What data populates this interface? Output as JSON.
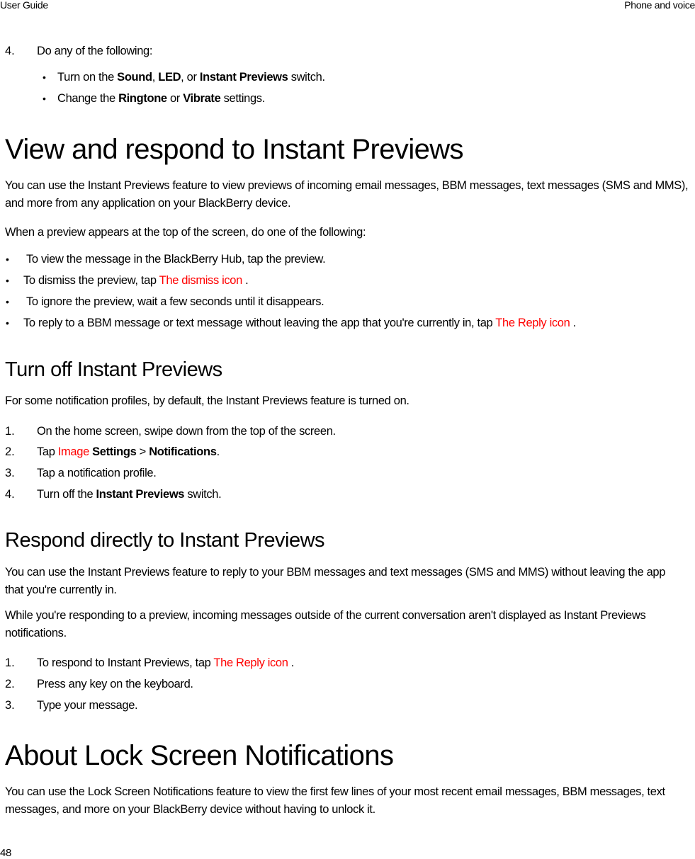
{
  "header": {
    "left": "User Guide",
    "right": "Phone and voice"
  },
  "page_number": "48",
  "intro_step": {
    "number": "4.",
    "text": "Do any of the following:",
    "bullets": [
      {
        "pre": "Turn on the ",
        "b1": "Sound",
        "mid1": ", ",
        "b2": "LED",
        "mid2": ", or ",
        "b3": "Instant Previews",
        "post": " switch."
      },
      {
        "pre": "Change the ",
        "b1": "Ringtone",
        "mid1": " or ",
        "b2": "Vibrate",
        "post": " settings."
      }
    ]
  },
  "section_view": {
    "title": "View and respond to Instant Previews",
    "para1": "You can use the Instant Previews feature to view previews of incoming email messages, BBM messages, text messages (SMS and MMS), and more from any application on your BlackBerry device.",
    "para2": "When a preview appears at the top of the screen, do one of the following:",
    "bullets": [
      {
        "text": "To view the message in the BlackBerry Hub, tap the preview."
      },
      {
        "text": "To dismiss the preview, tap ",
        "icon_alt": "The dismiss icon",
        "post": " ."
      },
      {
        "text": "To ignore the preview, wait a few seconds until it disappears."
      },
      {
        "text": "To reply to a BBM message or text message without leaving the app that you're currently in, tap ",
        "icon_alt": "The Reply icon",
        "post": " ."
      }
    ]
  },
  "section_turn_off": {
    "title": "Turn off Instant Previews",
    "para": "For some notification profiles, by default, the Instant Previews feature is turned on.",
    "steps": [
      {
        "number": "1.",
        "text": "On the home screen, swipe down from the top of the screen."
      },
      {
        "number": "2.",
        "pre": "Tap ",
        "icon_alt": "Image",
        "b1": "Settings",
        "mid": " > ",
        "b2": "Notifications",
        "post": "."
      },
      {
        "number": "3.",
        "text": "Tap a notification profile."
      },
      {
        "number": "4.",
        "pre": "Turn off the ",
        "b1": "Instant Previews",
        "post": " switch."
      }
    ]
  },
  "section_respond": {
    "title": "Respond directly to Instant Previews",
    "para1": "You can use the Instant Previews feature to reply to your BBM messages and text messages (SMS and MMS) without leaving the app that you're currently in.",
    "para2": "While you're responding to a preview, incoming messages outside of the current conversation aren't displayed as Instant Previews notifications.",
    "steps": [
      {
        "number": "1.",
        "pre": "To respond to Instant Previews, tap ",
        "icon_alt": "The Reply icon",
        "post": " ."
      },
      {
        "number": "2.",
        "text": "Press any key on the keyboard."
      },
      {
        "number": "3.",
        "text": "Type your message."
      }
    ]
  },
  "section_lock": {
    "title": "About Lock Screen Notifications",
    "para": "You can use the Lock Screen Notifications feature to view the first few lines of your most recent email messages, BBM messages, text messages, and more on your BlackBerry device without having to unlock it."
  },
  "colors": {
    "missing_image_text": "#ff0000",
    "text": "#000000"
  }
}
